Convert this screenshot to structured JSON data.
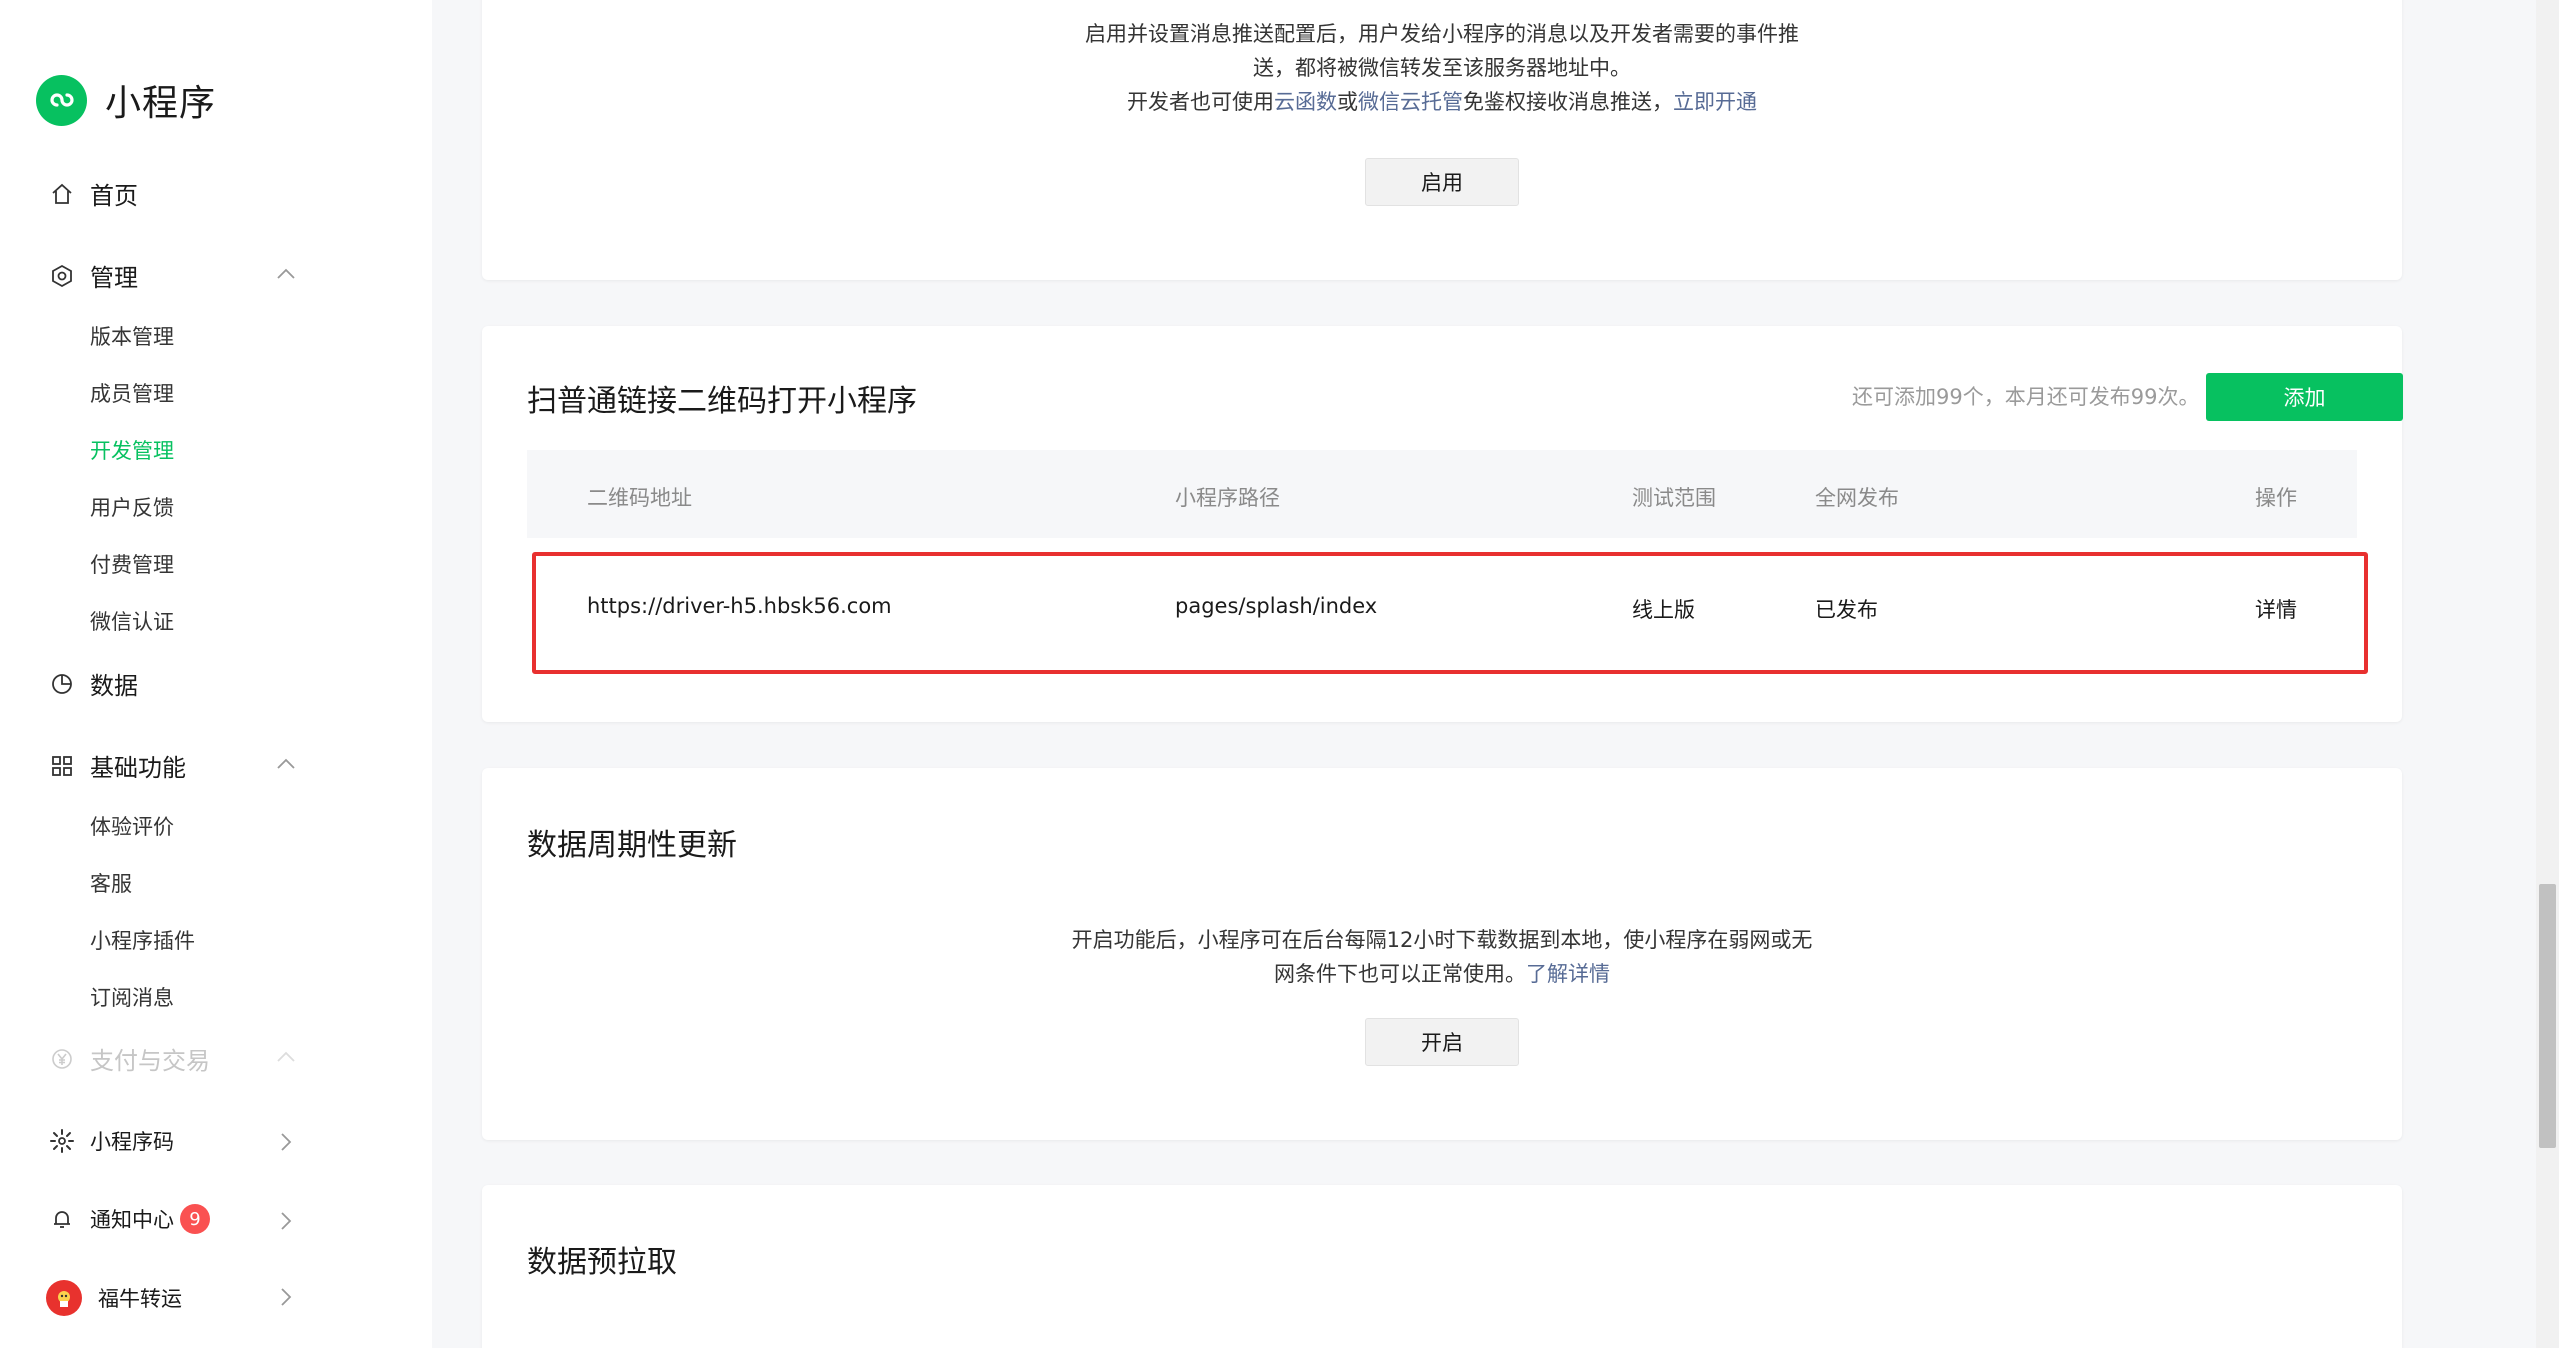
{
  "sidebar": {
    "app_name": "小程序",
    "home": "首页",
    "manage": {
      "label": "管理",
      "items": [
        "版本管理",
        "成员管理",
        "开发管理",
        "用户反馈",
        "付费管理",
        "微信认证"
      ],
      "active_index": 2
    },
    "data": "数据",
    "basic": {
      "label": "基础功能",
      "items": [
        "体验评价",
        "客服",
        "小程序插件",
        "订阅消息"
      ]
    },
    "payment": "支付与交易",
    "qrcode": "小程序码",
    "notify": {
      "label": "通知中心",
      "count": "9"
    },
    "account": "福牛转运"
  },
  "push_card": {
    "desc_line1": "启用并设置消息推送配置后，用户发给小程序的消息以及开发者需要的事件推",
    "desc_line2": "送，都将被微信转发至该服务器地址中。",
    "desc_line3_pre": "开发者也可使用",
    "link_cloud_fn": "云函数",
    "or": "或",
    "link_cloud_host": "微信云托管",
    "desc_line3_post": "免鉴权接收消息推送，",
    "link_open_now": "立即开通",
    "enable_button": "启用"
  },
  "qr_card": {
    "title": "扫普通链接二维码打开小程序",
    "quota": "还可添加99个，本月还可发布99次。",
    "add_button": "添加",
    "columns": [
      "二维码地址",
      "小程序路径",
      "测试范围",
      "全网发布",
      "操作"
    ],
    "rows": [
      {
        "url": "https://driver-h5.hbsk56.com",
        "path": "pages/splash/index",
        "scope": "线上版",
        "status": "已发布",
        "action": "详情"
      }
    ]
  },
  "periodic_card": {
    "title": "数据周期性更新",
    "desc_line1": "开启功能后，小程序可在后台每隔12小时下载数据到本地，使小程序在弱网或无",
    "desc_line2": "网条件下也可以正常使用。",
    "link": "了解详情",
    "button": "开启"
  },
  "prefetch_card": {
    "title": "数据预拉取"
  },
  "colors": {
    "brand_green": "#07c160",
    "link_blue": "#576b95",
    "highlight_red": "#e8302f",
    "badge_red": "#fa5151"
  }
}
